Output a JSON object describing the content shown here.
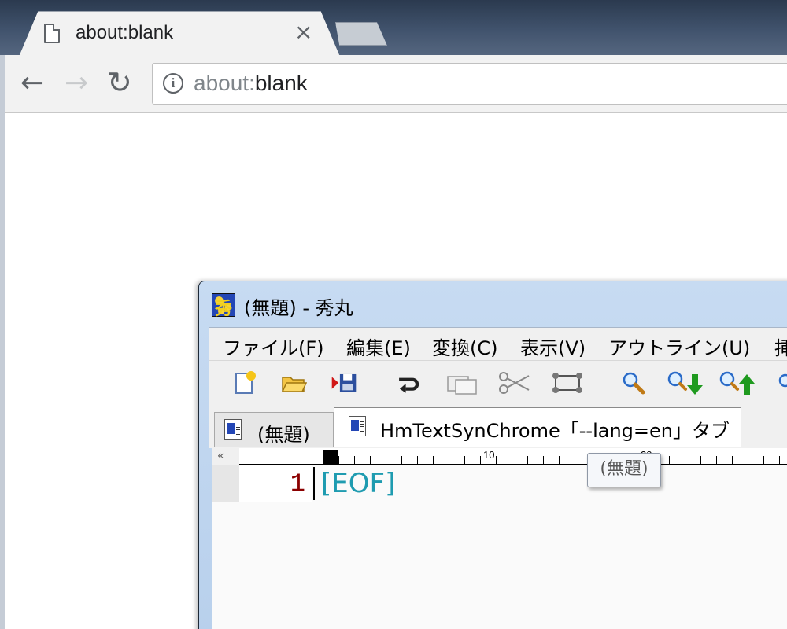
{
  "browser": {
    "tab_title": "about:blank",
    "tab_close": "×",
    "url_scheme": "about:",
    "url_rest": "blank",
    "info_icon": "i",
    "back_glyph": "←",
    "forward_glyph": "→",
    "reload_glyph": "↻"
  },
  "hidemaru": {
    "title": "(無題) - 秀丸",
    "menu": [
      "ファイル(F)",
      "編集(E)",
      "変換(C)",
      "表示(V)",
      "アウトライン(U)",
      "挿"
    ],
    "toolbar_icons": [
      "new-file-icon",
      "open-folder-icon",
      "save-icon",
      "undo-icon",
      "copy-icon",
      "cut-icon",
      "paste-icon",
      "search-icon",
      "search-down-icon",
      "search-up-icon",
      "grep-icon"
    ],
    "tabs": [
      "(無題)",
      "HmTextSynChrome「--lang=en」タブ"
    ],
    "ruler_collapse": "«",
    "ruler_labels": [
      "10",
      "20"
    ],
    "line_number": "1",
    "eof_marker": "[EOF]",
    "tooltip": "(無題)"
  },
  "colors": {
    "line_number": "#8b0000",
    "eof": "#1e9bb0"
  }
}
